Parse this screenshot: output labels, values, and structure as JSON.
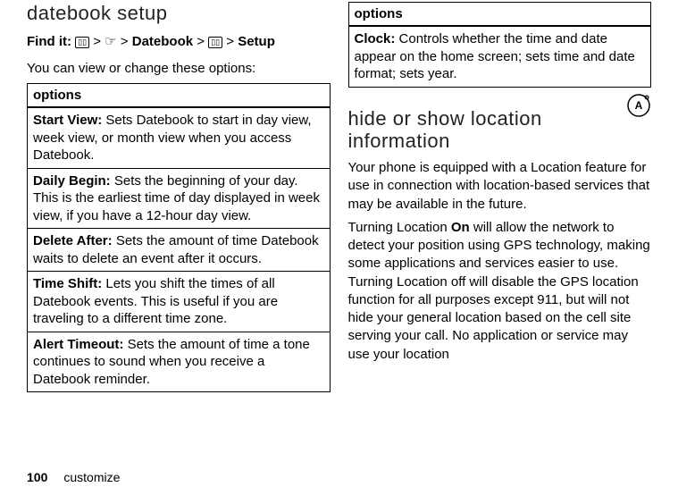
{
  "left": {
    "heading": "datebook setup",
    "findit_label": "Find it:",
    "path_datebook": "Datebook",
    "path_setup": "Setup",
    "intro": "You can view or change these options:",
    "options_header": "options",
    "rows": [
      {
        "label": "Start View:",
        "text": "Sets Datebook to start in day view, week view, or month view when you access Datebook."
      },
      {
        "label": "Daily Begin:",
        "text": "Sets the beginning of your day. This is the earliest time of day displayed in week view, if you have a 12-hour day view."
      },
      {
        "label": "Delete After:",
        "text": "Sets the amount of time Datebook waits to delete an event after it occurs."
      },
      {
        "label": "Time Shift:",
        "text": "Lets you shift the times of all Datebook events. This is useful if you are traveling to a different time zone."
      },
      {
        "label": "Alert Timeout:",
        "text": "Sets the amount of time a tone continues to sound when you receive a Datebook reminder."
      }
    ]
  },
  "right": {
    "options_header": "options",
    "clock_label": "Clock:",
    "clock_text": "Controls whether the time and date appear on the home screen; sets time and date format; sets year.",
    "heading": "hide or show location information",
    "para1": "Your phone is equipped with a Location feature for use in connection with location-based services that may be available in the future.",
    "para2a": "Turning Location ",
    "on": "On",
    "para2b": " will allow the network to detect your position using GPS technology, making some applications and services easier to use. Turning Location off will disable the GPS location function for all purposes except 911, but will not hide your general location based on the cell site serving your call. No application or service may use your location"
  },
  "footer": {
    "page": "100",
    "section": "customize"
  }
}
